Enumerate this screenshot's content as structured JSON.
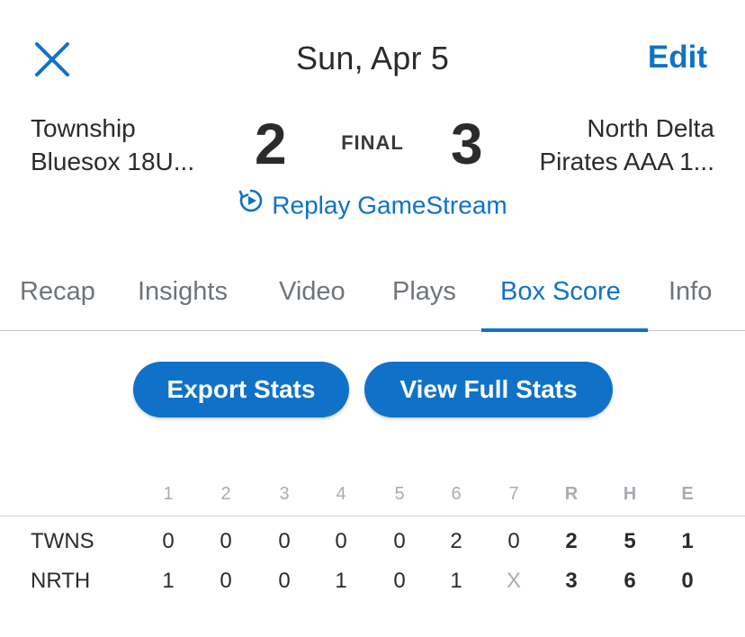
{
  "header": {
    "title": "Sun, Apr 5",
    "edit_label": "Edit",
    "close_icon": "close-icon"
  },
  "game": {
    "away_team_line1": "Township",
    "away_team_line2": "Bluesox 18U...",
    "home_team_line1": "North Delta",
    "home_team_line2": "Pirates AAA 1...",
    "away_score": "2",
    "home_score": "3",
    "status": "FINAL"
  },
  "replay": {
    "label": "Replay GameStream",
    "icon": "replay-icon"
  },
  "tabs": [
    {
      "label": "Recap"
    },
    {
      "label": "Insights"
    },
    {
      "label": "Video"
    },
    {
      "label": "Plays"
    },
    {
      "label": "Box Score",
      "active": true
    },
    {
      "label": "Info"
    }
  ],
  "actions": {
    "export_label": "Export Stats",
    "full_label": "View Full Stats"
  },
  "box_score": {
    "headers": [
      "1",
      "2",
      "3",
      "4",
      "5",
      "6",
      "7",
      "R",
      "H",
      "E"
    ],
    "rows": [
      {
        "team": "TWNS",
        "cells": [
          "0",
          "0",
          "0",
          "0",
          "0",
          "2",
          "0",
          "2",
          "5",
          "1"
        ]
      },
      {
        "team": "NRTH",
        "cells": [
          "1",
          "0",
          "0",
          "1",
          "0",
          "1",
          "X",
          "3",
          "6",
          "0"
        ]
      }
    ]
  },
  "colors": {
    "accent": "#0f72c8",
    "text": "#2b2b2b",
    "muted": "#6e747c",
    "dim": "#a8adb3"
  }
}
